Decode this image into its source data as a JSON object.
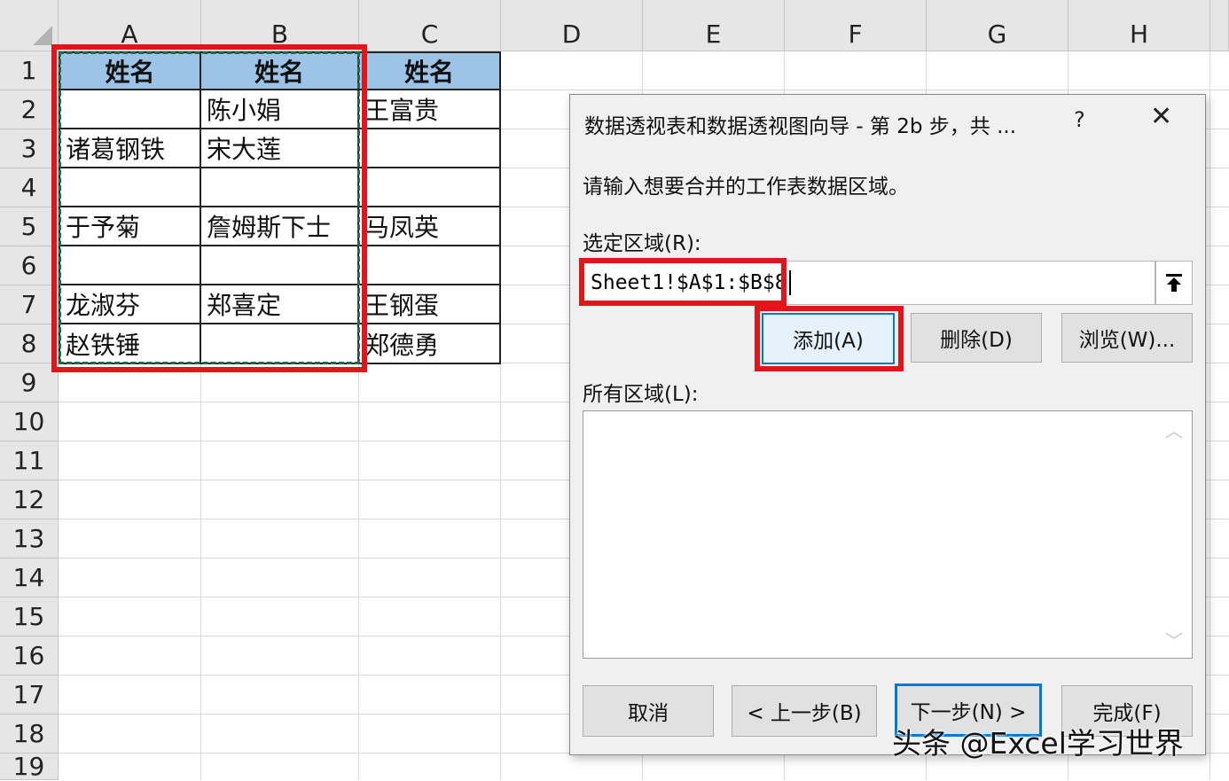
{
  "sheet": {
    "columns": [
      "A",
      "B",
      "C",
      "D",
      "E",
      "F",
      "G",
      "H"
    ],
    "rows": [
      "1",
      "2",
      "3",
      "4",
      "5",
      "6",
      "7",
      "8",
      "9",
      "10",
      "11",
      "12",
      "13",
      "14",
      "15",
      "16",
      "17",
      "18",
      "19"
    ],
    "cells": {
      "A1": "姓名",
      "B1": "姓名",
      "C1": "姓名",
      "A2": "",
      "B2": "陈小娟",
      "C2": "王富贵",
      "A3": "诸葛钢铁",
      "B3": "宋大莲",
      "C3": "",
      "A4": "",
      "B4": "",
      "C4": "",
      "A5": "于予菊",
      "B5": "詹姆斯下士",
      "C5": "马凤英",
      "A6": "",
      "B6": "",
      "C6": "",
      "A7": "龙淑芬",
      "B7": "郑喜定",
      "C7": "王钢蛋",
      "A8": "赵铁锤",
      "B8": "",
      "C8": "郑德勇"
    },
    "header_fill": "#9dc3e6",
    "highlight_color": "#e0161b"
  },
  "dialog": {
    "title": "数据透视表和数据透视图向导 - 第 2b 步，共 ...",
    "help": "?",
    "close": "✕",
    "prompt": "请输入想要合并的工作表数据区域。",
    "range_label": "选定区域(R):",
    "range_value": "Sheet1!$A$1:$B$8",
    "collapse_icon": "upload-arrow-icon",
    "add_button": "添加(A)",
    "delete_button": "删除(D)",
    "browse_button": "浏览(W)...",
    "all_ranges_label": "所有区域(L):",
    "all_ranges": [],
    "cancel_button": "取消",
    "back_button": "< 上一步(B)",
    "next_button": "下一步(N) >",
    "finish_button": "完成(F)"
  },
  "watermark": "头条 @Excel学习世界"
}
